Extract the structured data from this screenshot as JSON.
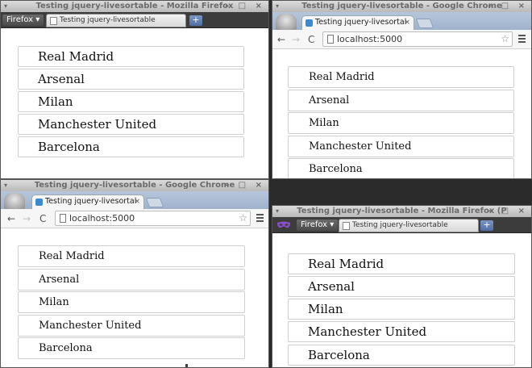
{
  "teams": [
    "Real Madrid",
    "Arsenal",
    "Milan",
    "Manchester United",
    "Barcelona"
  ],
  "firefox": {
    "title": "Testing jquery-livesortable - Mozilla Firefox",
    "title_private": "Testing jquery-livesortable - Mozilla Firefox (P",
    "menu_label": "Firefox",
    "tab_label": "Testing jquery-livesortable",
    "new_tab_symbol": "+",
    "window_buttons": "– □ ×"
  },
  "chrome": {
    "title": "Testing jquery-livesortable - Google Chrome",
    "tab_label": "Testing jquery-livesortal",
    "tab_close": "×",
    "url": "localhost:5000",
    "back_symbol": "←",
    "forward_symbol": "→",
    "reload_symbol": "C",
    "star_symbol": "☆",
    "window_buttons": "– □ ×"
  },
  "colors": {
    "firefox_tabstrip": "#3c3c3c",
    "chrome_tabstrip": "#b6c6dc",
    "row_border": "#cfcfcf"
  },
  "icons": [
    "window-menu-icon",
    "page-icon",
    "new-tab-icon",
    "favicon",
    "close-icon",
    "back-icon",
    "forward-icon",
    "reload-icon",
    "star-icon",
    "menu-icon",
    "avatar-icon",
    "private-mask-icon"
  ]
}
